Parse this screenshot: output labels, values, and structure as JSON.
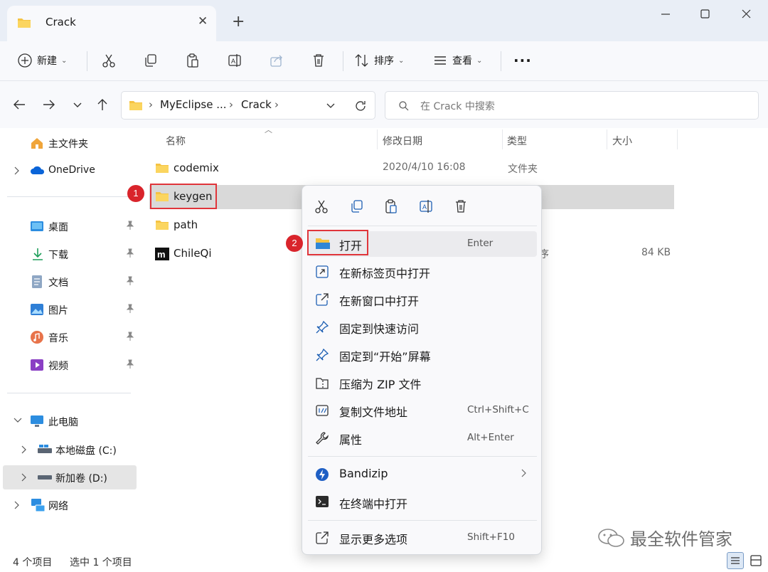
{
  "window": {
    "tab_title": "Crack",
    "tab_close_glyph": "✕",
    "new_tab_glyph": "+"
  },
  "toolbar": {
    "new_label": "新建",
    "sort_label": "排序",
    "view_label": "查看",
    "more_glyph": "···"
  },
  "address": {
    "crumbs": [
      "MyEclipse ...",
      "Crack"
    ],
    "search_placeholder": "在 Crack 中搜索"
  },
  "sidebar": {
    "home": "主文件夹",
    "onedrive": "OneDrive",
    "quick": [
      {
        "label": "桌面",
        "icon": "desktop-icon"
      },
      {
        "label": "下载",
        "icon": "download-icon"
      },
      {
        "label": "文档",
        "icon": "documents-icon"
      },
      {
        "label": "图片",
        "icon": "pictures-icon"
      },
      {
        "label": "音乐",
        "icon": "music-icon"
      },
      {
        "label": "视频",
        "icon": "videos-icon"
      }
    ],
    "this_pc": "此电脑",
    "drive_c": "本地磁盘 (C:)",
    "drive_d": "新加卷 (D:)",
    "network": "网络"
  },
  "columns": {
    "name": "名称",
    "date": "修改日期",
    "type": "类型",
    "size": "大小"
  },
  "files": [
    {
      "name": "codemix",
      "date": "2020/4/10 16:08",
      "type": "文件夹",
      "size": ""
    },
    {
      "name": "keygen",
      "date": "",
      "type": "",
      "size": ""
    },
    {
      "name": "path",
      "date": "",
      "type": "",
      "size": ""
    },
    {
      "name": "ChileQi",
      "date": "",
      "type": "序",
      "size": "84 KB"
    }
  ],
  "statusbar": {
    "count": "4 个项目",
    "selected": "选中 1 个项目"
  },
  "context_menu": {
    "items": [
      {
        "label": "打开",
        "shortcut": "Enter"
      },
      {
        "label": "在新标签页中打开",
        "shortcut": ""
      },
      {
        "label": "在新窗口中打开",
        "shortcut": ""
      },
      {
        "label": "固定到快速访问",
        "shortcut": ""
      },
      {
        "label": "固定到“开始”屏幕",
        "shortcut": ""
      },
      {
        "label": "压缩为 ZIP 文件",
        "shortcut": ""
      },
      {
        "label": "复制文件地址",
        "shortcut": "Ctrl+Shift+C"
      },
      {
        "label": "属性",
        "shortcut": "Alt+Enter"
      },
      {
        "label": "Bandizip",
        "shortcut": ""
      },
      {
        "label": "在终端中打开",
        "shortcut": ""
      },
      {
        "label": "显示更多选项",
        "shortcut": "Shift+F10"
      }
    ]
  },
  "annotations": {
    "badge1": "1",
    "badge2": "2"
  },
  "watermark": {
    "text": "最全软件管家"
  },
  "colors": {
    "accent": "#0067c0",
    "folder": "#f5c343",
    "highlight_red": "#e0353b",
    "selected_row": "#d9d9d9"
  }
}
